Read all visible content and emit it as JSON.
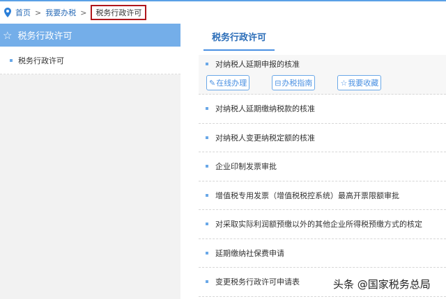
{
  "breadcrumb": {
    "home": "首页",
    "sep": ">",
    "level2": "我要办税",
    "current": "税务行政许可"
  },
  "sidebar": {
    "title": "税务行政许可",
    "items": [
      {
        "label": "税务行政许可"
      }
    ]
  },
  "main": {
    "tab": "税务行政许可",
    "items": [
      {
        "label": "对纳税人延期申报的核准",
        "actions": [
          "在线办理",
          "办税指南",
          "我要收藏"
        ]
      },
      {
        "label": "对纳税人延期缴纳税款的核准"
      },
      {
        "label": "对纳税人变更纳税定额的核准"
      },
      {
        "label": "企业印制发票审批"
      },
      {
        "label": "增值税专用发票（增值税税控系统）最高开票限额审批"
      },
      {
        "label": "对采取实际利润额预缴以外的其他企业所得税预缴方式的核定"
      },
      {
        "label": "延期缴纳社保费申请"
      },
      {
        "label": "变更税务行政许可申请表"
      }
    ]
  },
  "watermark": "头条 @国家税务总局"
}
